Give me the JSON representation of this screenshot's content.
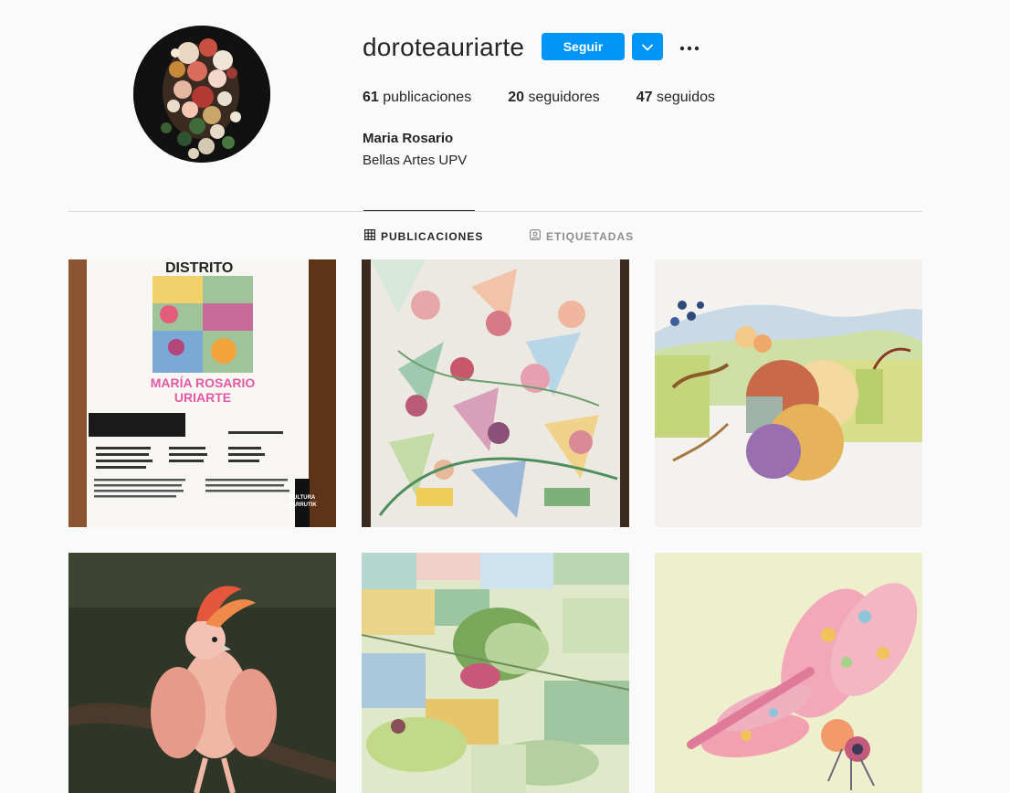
{
  "profile": {
    "username": "doroteauriarte",
    "follow_label": "Seguir",
    "full_name": "Maria Rosario",
    "bio": "Bellas Artes UPV",
    "stats": {
      "posts_count": "61",
      "posts_label": "publicaciones",
      "followers_count": "20",
      "followers_label": "seguidores",
      "following_count": "47",
      "following_label": "seguidos"
    }
  },
  "tabs": {
    "posts_label": "PUBLICACIONES",
    "tagged_label": "ETIQUETADAS"
  },
  "posters": {
    "title": "DISTRITO",
    "name_line1": "MARÍA ROSARIO",
    "name_line2": "URIARTE",
    "corner_line1": "KULTURA",
    "corner_line2": "BARRUTIK"
  },
  "colors": {
    "accent": "#0095f6",
    "divider": "#dbdbdb",
    "muted": "#8e8e8e",
    "text": "#262626"
  },
  "icons": {
    "dropdown": "chevron-down-icon",
    "more": "more-horizontal-icon",
    "grid": "grid-icon",
    "tagged": "tagged-user-icon"
  }
}
